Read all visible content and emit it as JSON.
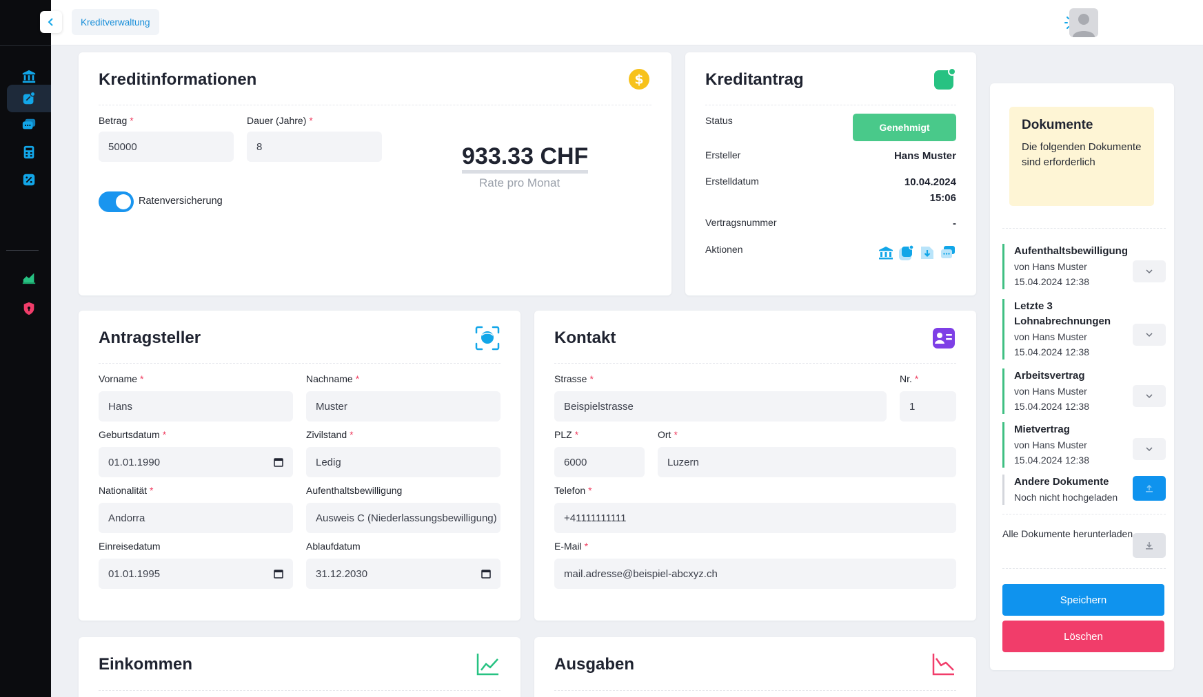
{
  "topbar": {
    "breadcrumb": "Kreditverwaltung"
  },
  "colors": {
    "accent": "#0f93ee",
    "success": "#49c98a",
    "danger": "#f13d6a",
    "note_bg": "#fef5d5"
  },
  "kreditinfo": {
    "title": "Kreditinformationen",
    "betrag_label": "Betrag",
    "betrag_value": "50000",
    "dauer_label": "Dauer (Jahre)",
    "dauer_value": "8",
    "rate_value": "933.33 CHF",
    "rate_label": "Rate pro Monat",
    "toggle_label": "Ratenversicherung",
    "toggle_on": true
  },
  "kreditantrag": {
    "title": "Kreditantrag",
    "status_label": "Status",
    "status_value": "Genehmigt",
    "ersteller_label": "Ersteller",
    "ersteller_value": "Hans Muster",
    "datum_label": "Erstelldatum",
    "datum_value": "10.04.2024",
    "zeit_value": "15:06",
    "vertrag_label": "Vertragsnummer",
    "vertrag_value": "-",
    "aktionen_label": "Aktionen"
  },
  "antragsteller": {
    "title": "Antragsteller",
    "vorname_label": "Vorname",
    "vorname_value": "Hans",
    "nachname_label": "Nachname",
    "nachname_value": "Muster",
    "geburtsdatum_label": "Geburtsdatum",
    "geburtsdatum_value": "01.01.1990",
    "zivilstand_label": "Zivilstand",
    "zivilstand_value": "Ledig",
    "nationalitaet_label": "Nationalität",
    "nationalitaet_value": "Andorra",
    "aufenthalt_label": "Aufenthaltsbewilligung",
    "aufenthalt_value": "Ausweis C (Niederlassungsbewilligung)",
    "einreise_label": "Einreisedatum",
    "einreise_value": "01.01.1995",
    "ablauf_label": "Ablaufdatum",
    "ablauf_value": "31.12.2030"
  },
  "kontakt": {
    "title": "Kontakt",
    "strasse_label": "Strasse",
    "strasse_value": "Beispielstrasse",
    "nr_label": "Nr.",
    "nr_value": "1",
    "plz_label": "PLZ",
    "plz_value": "6000",
    "ort_label": "Ort",
    "ort_value": "Luzern",
    "telefon_label": "Telefon",
    "telefon_value": "+41111111111",
    "email_label": "E-Mail",
    "email_value": "mail.adresse@beispiel-abcxyz.ch"
  },
  "einkommen": {
    "title": "Einkommen"
  },
  "ausgaben": {
    "title": "Ausgaben"
  },
  "dokumente": {
    "title": "Dokumente",
    "text": "Die folgenden Dokumente sind erforderlich",
    "items": [
      {
        "name": "Aufenthaltsbewilligung",
        "by": "von Hans Muster",
        "date": "15.04.2024 12:38"
      },
      {
        "name": "Letzte 3 Lohnabrechnungen",
        "by": "von Hans Muster",
        "date": "15.04.2024 12:38"
      },
      {
        "name": "Arbeitsvertrag",
        "by": "von Hans Muster",
        "date": "15.04.2024 12:38"
      },
      {
        "name": "Mietvertrag",
        "by": "von Hans Muster",
        "date": "15.04.2024 12:38"
      },
      {
        "name": "Andere Dokumente",
        "by": "Noch nicht hochgeladen"
      }
    ],
    "download_all": "Alle Dokumente herunterladen",
    "save_label": "Speichern",
    "delete_label": "Löschen"
  }
}
